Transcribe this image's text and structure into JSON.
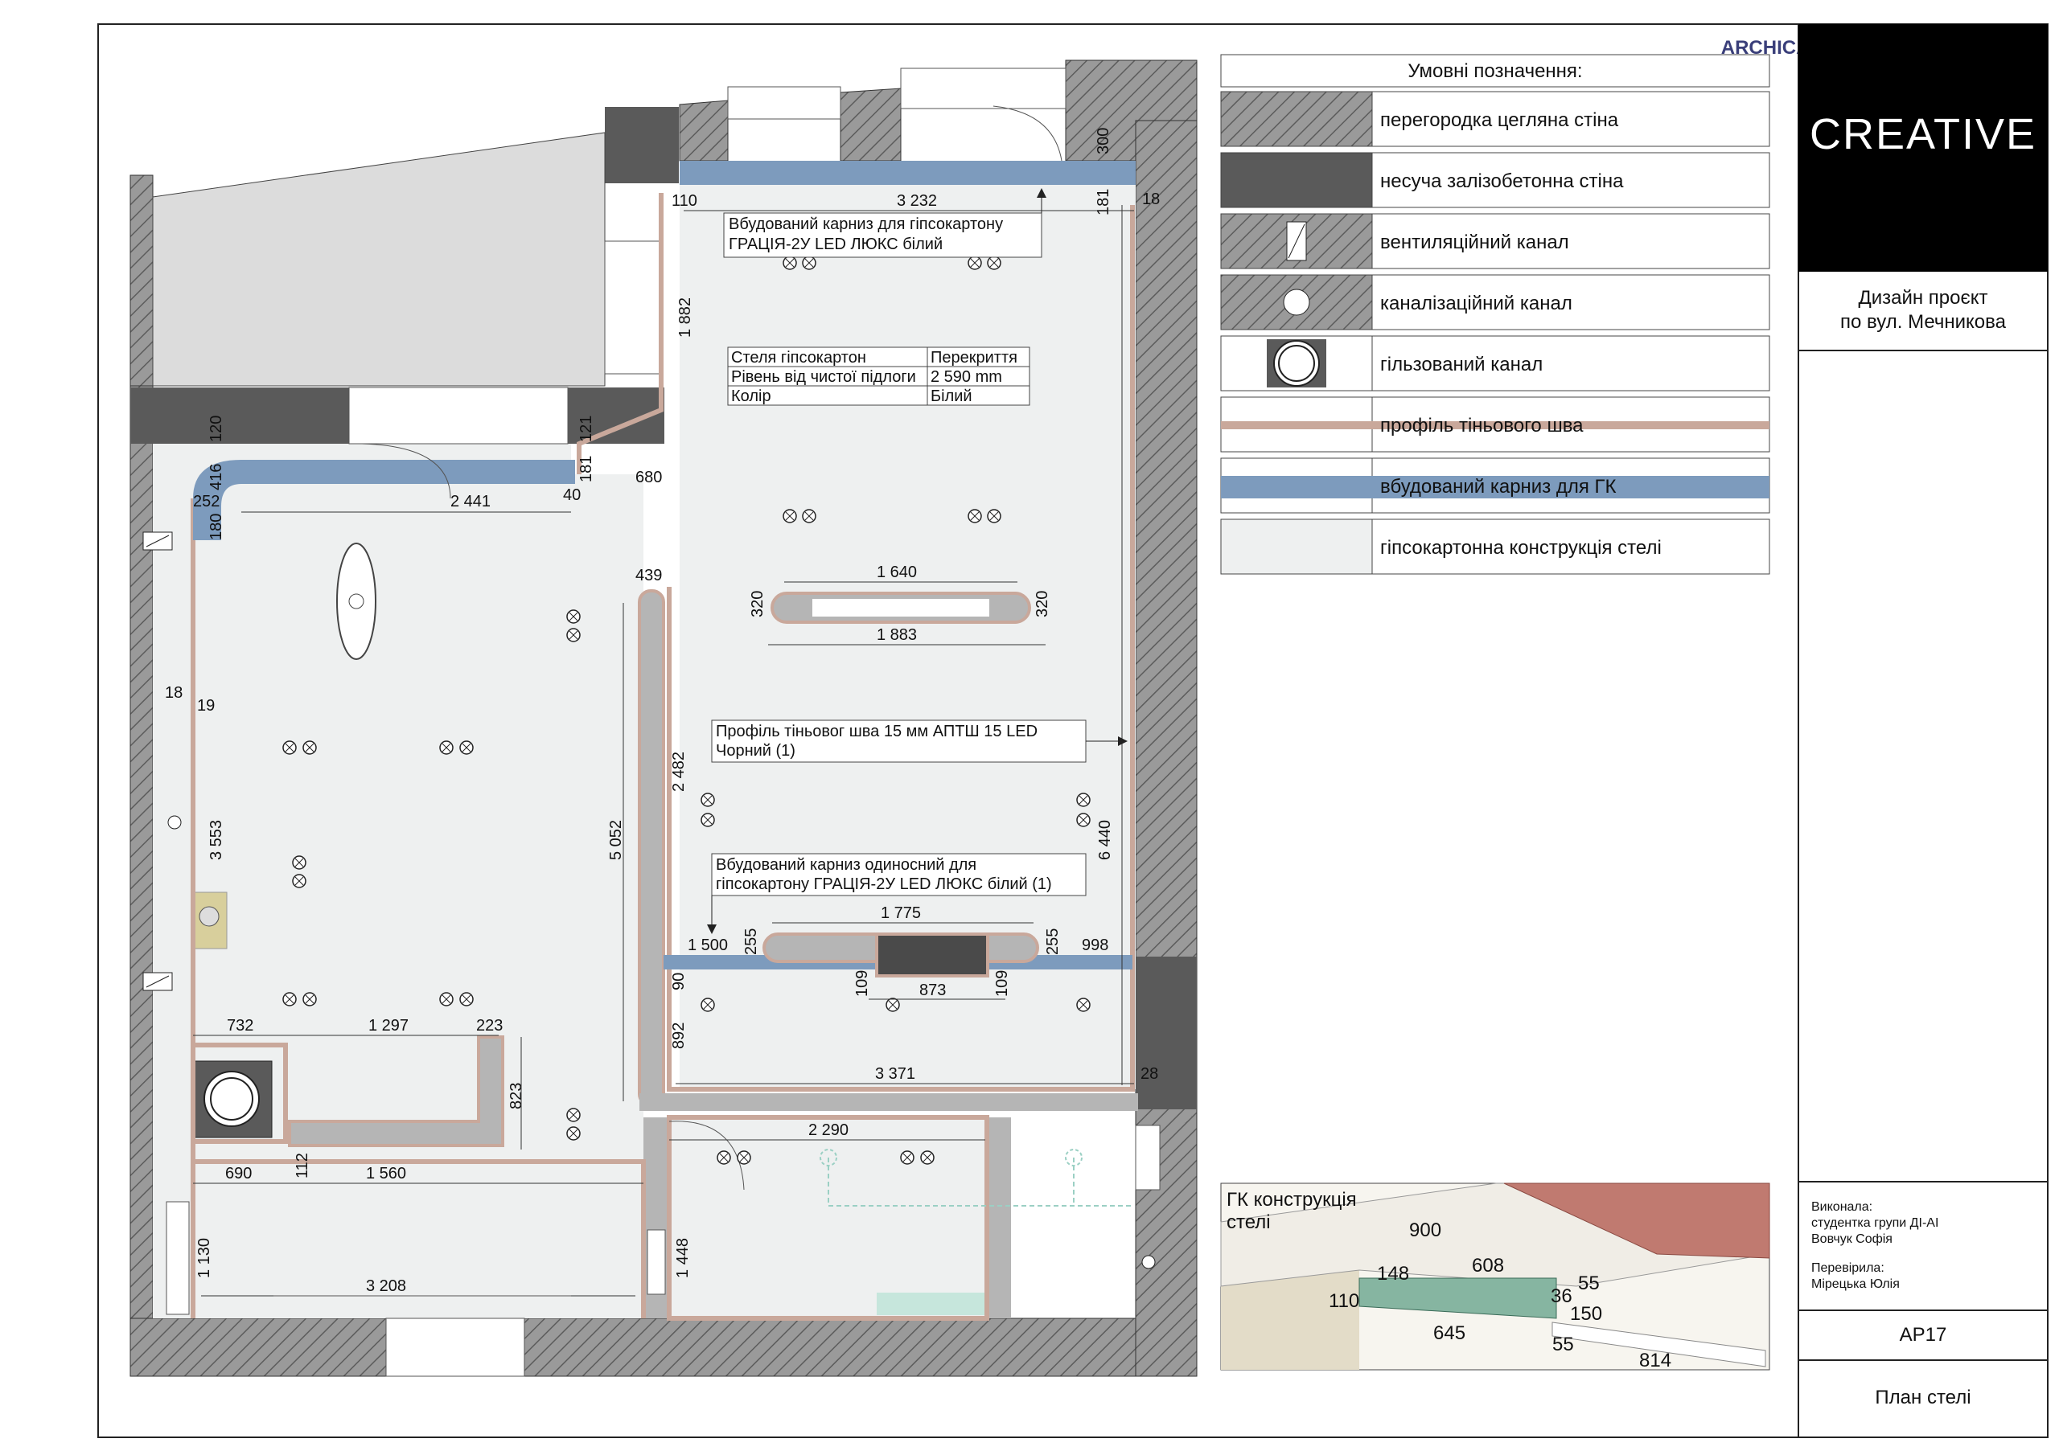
{
  "watermark": "ARCHICAD EDUCATION VERSION",
  "colors": {
    "brick_hatch": "#8c8c8c",
    "concrete": "#5a5a5a",
    "shadow_profile": "#c9a89b",
    "cornice": "#7d9bbd",
    "drywall": "#eef0f0",
    "partition_gray": "#b5b5b5",
    "iso_green": "#86b5a1",
    "iso_red": "#c07a70",
    "logo_bg": "#000000"
  },
  "legend": {
    "title": "Умовні позначення:",
    "items": [
      {
        "icon": "brick-hatch",
        "label": "перегородка цегляна стіна"
      },
      {
        "icon": "concrete-fill",
        "label": "несуча залізобетонна стіна"
      },
      {
        "icon": "vent-channel",
        "label": "вентиляційний канал"
      },
      {
        "icon": "sewer-channel",
        "label": "каналізаційний канал"
      },
      {
        "icon": "sleeve-channel",
        "label": "гільзований канал"
      },
      {
        "icon": "shadow-line",
        "label": "профіль тіньового шва"
      },
      {
        "icon": "cornice-line",
        "label": "вбудований карниз для ГК"
      },
      {
        "icon": "drywall-fill",
        "label": "гіпсокартонна конструкція стелі"
      }
    ]
  },
  "title_block": {
    "logo": "CREATIVE",
    "project_line1": "Дизайн проєкт",
    "project_line2": "по вул. Мечникова",
    "performed_label": "Виконала:",
    "performed_line1": "студентка групи ДІ-АІ",
    "performed_name": "Вовчук Софія",
    "checked_label": "Перевірила:",
    "checked_name": "Мірецька Юлія",
    "sheet_code": "АР17",
    "sheet_name": "План стелі"
  },
  "notes": {
    "cornice_top_line1": "Вбудований карниз для гіпсокартону",
    "cornice_top_line2": "ГРАЦІЯ-2У LED ЛЮКС білий",
    "shadow_line1": "Профіль тіньовог шва 15 мм АПТШ 15 LED",
    "shadow_line2": "Чорний (1)",
    "cornice_single_line1": "Вбудований карниз одиносний для",
    "cornice_single_line2": "гіпсокартону ГРАЦІЯ-2У LED ЛЮКС білий (1)"
  },
  "ceiling_table": {
    "rows": [
      [
        "Стеля гіпсокартон",
        "Перекриття"
      ],
      [
        "Рівень від чистої підлоги",
        "2 590 mm"
      ],
      [
        "Колір",
        "Білий"
      ]
    ]
  },
  "dimensions": {
    "d110": "110",
    "d3232": "3 232",
    "d300": "300",
    "d181a": "181",
    "d18a": "18",
    "d1882": "1 882",
    "d120": "120",
    "d416": "416",
    "d121": "121",
    "d181b": "181",
    "d40": "40",
    "d680": "680",
    "d252": "252",
    "d2441": "2 441",
    "d180": "180",
    "d439": "439",
    "d1640": "1 640",
    "d320a": "320",
    "d320b": "320",
    "d1883": "1 883",
    "d18b": "18",
    "d19": "19",
    "d2482": "2 482",
    "d5052": "5 052",
    "d3553": "3 553",
    "d6440": "6 440",
    "d1775": "1 775",
    "d1500": "1 500",
    "d255a": "255",
    "d255b": "255",
    "d998": "998",
    "d90": "90",
    "d109a": "109",
    "d109b": "109",
    "d873": "873",
    "d892": "892",
    "d732": "732",
    "d1297": "1 297",
    "d223": "223",
    "d3371": "3 371",
    "d28": "28",
    "d823": "823",
    "d2290": "2 290",
    "d690": "690",
    "d112": "112",
    "d1560": "1 560",
    "d1130": "1 130",
    "d1448": "1 448",
    "d3208": "3 208"
  },
  "iso": {
    "title_line1": "ГК конструкція",
    "title_line2": "стелі",
    "n900": "900",
    "n608": "608",
    "n148": "148",
    "n36": "36",
    "n55a": "55",
    "n110": "110",
    "n150": "150",
    "n645": "645",
    "n55b": "55",
    "n814": "814"
  }
}
